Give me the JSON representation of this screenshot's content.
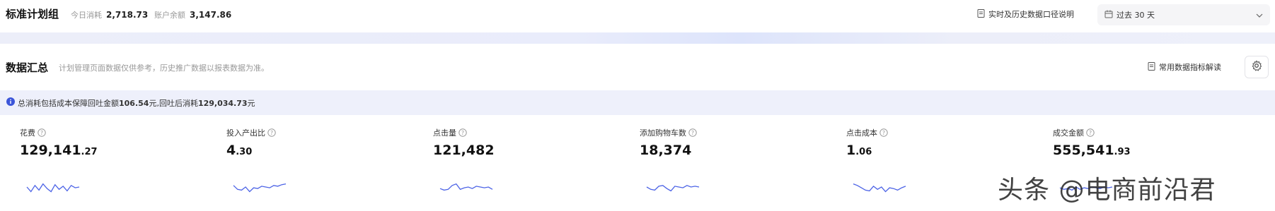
{
  "header": {
    "title": "标准计划组",
    "today_label": "今日消耗",
    "today_value": "2,718.73",
    "balance_label": "账户余额",
    "balance_value": "3,147.86",
    "realtime_link": "实时及历史数据口径说明",
    "date_range": "过去 30 天"
  },
  "summary": {
    "title": "数据汇总",
    "desc": "计划管理页面数据仅供参考，历史推广数据以报表数据为准。",
    "help_link": "常用数据指标解读"
  },
  "notice": {
    "prefix": "总消耗包括成本保障回吐金额",
    "amount1": "106.54",
    "mid": "元,回吐后消耗",
    "amount2": "129,034.73",
    "suffix": "元"
  },
  "metrics": [
    {
      "label": "花费",
      "int": "129,141",
      "dec": ".27",
      "spark": [
        0.5,
        0.2,
        0.6,
        0.3,
        0.7,
        0.4,
        0.2,
        0.65,
        0.35,
        0.55,
        0.25,
        0.6,
        0.45,
        0.5
      ]
    },
    {
      "label": "投入产出比",
      "int": "4",
      "dec": ".30",
      "spark": [
        0.6,
        0.35,
        0.3,
        0.5,
        0.2,
        0.45,
        0.4,
        0.55,
        0.5,
        0.45,
        0.6,
        0.55,
        0.65,
        0.7
      ]
    },
    {
      "label": "点击量",
      "int": "121,482",
      "dec": "",
      "spark": [
        0.4,
        0.3,
        0.35,
        0.6,
        0.7,
        0.35,
        0.45,
        0.5,
        0.4,
        0.55,
        0.5,
        0.45,
        0.5,
        0.35
      ]
    },
    {
      "label": "添加购物车数",
      "int": "18,374",
      "dec": "",
      "spark": [
        0.5,
        0.35,
        0.3,
        0.55,
        0.6,
        0.4,
        0.25,
        0.55,
        0.5,
        0.45,
        0.6,
        0.5,
        0.55,
        0.5
      ]
    },
    {
      "label": "点击成本",
      "int": "1",
      "dec": ".06",
      "spark": [
        0.7,
        0.6,
        0.45,
        0.3,
        0.25,
        0.55,
        0.35,
        0.5,
        0.2,
        0.45,
        0.4,
        0.3,
        0.45,
        0.55
      ]
    },
    {
      "label": "成交金额",
      "int": "555,541",
      "dec": ".93",
      "spark": [
        0.45,
        0.35,
        0.4,
        0.3,
        0.5,
        0.35,
        0.45,
        0.4,
        0.5,
        0.45,
        0.4,
        0.5,
        0.45,
        0.5
      ]
    }
  ],
  "watermark": "头条 @电商前沿君",
  "colors": {
    "spark": "#4c63e6",
    "notice_bg": "#eef0fb",
    "info_icon": "#3b55d9"
  }
}
